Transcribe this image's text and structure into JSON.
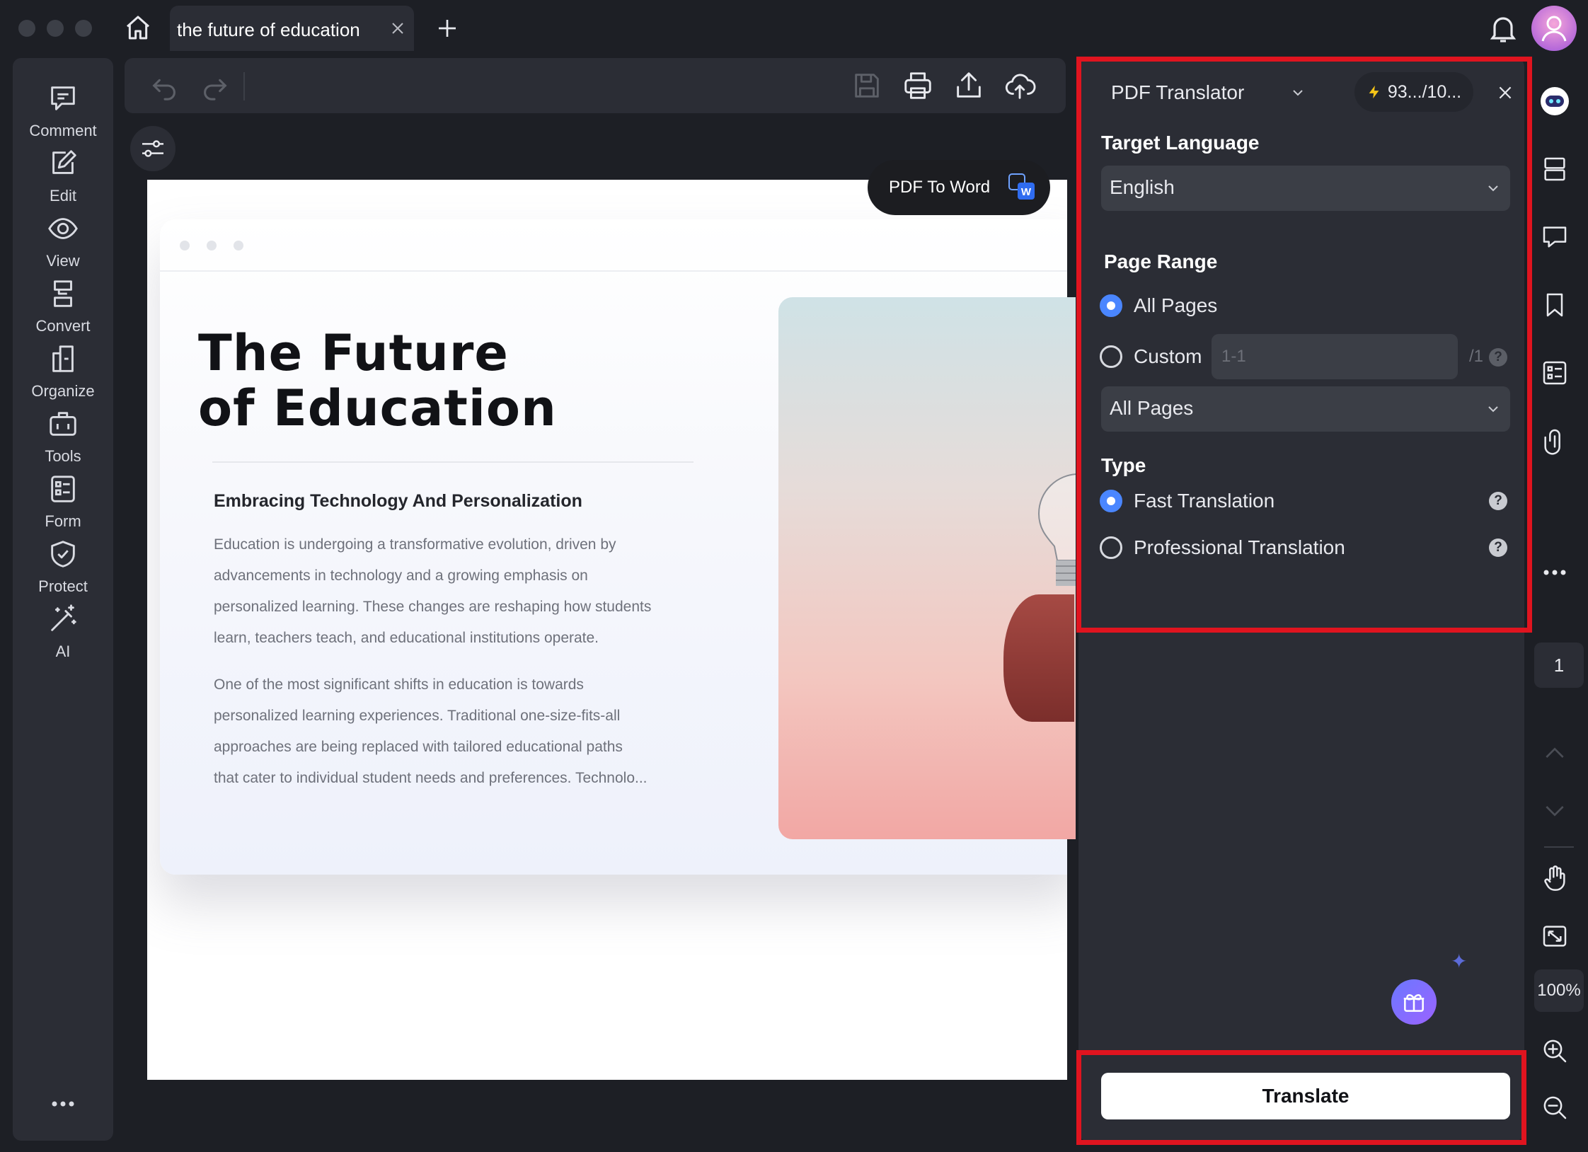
{
  "tab": {
    "title": "the future of education"
  },
  "left_rail": {
    "items": [
      {
        "label": "Comment",
        "icon": "comment-icon"
      },
      {
        "label": "Edit",
        "icon": "edit-icon"
      },
      {
        "label": "View",
        "icon": "view-icon"
      },
      {
        "label": "Convert",
        "icon": "convert-icon"
      },
      {
        "label": "Organize",
        "icon": "organize-icon"
      },
      {
        "label": "Tools",
        "icon": "tools-icon"
      },
      {
        "label": "Form",
        "icon": "form-icon"
      },
      {
        "label": "Protect",
        "icon": "protect-icon"
      },
      {
        "label": "AI",
        "icon": "ai-wand-icon"
      }
    ]
  },
  "toolbar": {
    "icons": [
      "undo-icon",
      "redo-icon",
      "save-icon",
      "print-icon",
      "share-icon",
      "cloud-upload-icon"
    ]
  },
  "document": {
    "title_line1": "The Future",
    "title_line2": "of Education",
    "subtitle": "Embracing Technology And Personalization",
    "para1_lines": [
      "Education is undergoing a transformative evolution, driven by",
      "advancements in technology and a growing emphasis on",
      "personalized learning. These changes are reshaping how students",
      "learn, teachers teach, and educational institutions operate."
    ],
    "para2_lines": [
      "One of the most significant shifts in education is towards",
      "personalized learning experiences. Traditional one-size-fits-all",
      "approaches are being replaced with tailored educational paths",
      "that cater to individual student needs and preferences. Technolo..."
    ]
  },
  "pdf_to_word": {
    "label": "PDF To Word"
  },
  "translator": {
    "title": "PDF Translator",
    "credits": "93.../10...",
    "target_language_label": "Target Language",
    "target_language_value": "English",
    "page_range_label": "Page Range",
    "all_pages_label": "All Pages",
    "custom_label": "Custom",
    "custom_placeholder": "1-1",
    "custom_total": "/1",
    "page_subset_value": "All Pages",
    "type_label": "Type",
    "fast_label": "Fast Translation",
    "professional_label": "Professional Translation",
    "help_glyph": "?",
    "translate_label": "Translate",
    "selected_range": "All Pages",
    "selected_type": "Fast Translation"
  },
  "right_rail": {
    "page_number": "1",
    "zoom": "100%"
  },
  "colors": {
    "accent": "#4a86ff",
    "highlight": "#e0141f",
    "panel_bg": "#2b2d35",
    "app_bg": "#1d1f25"
  }
}
